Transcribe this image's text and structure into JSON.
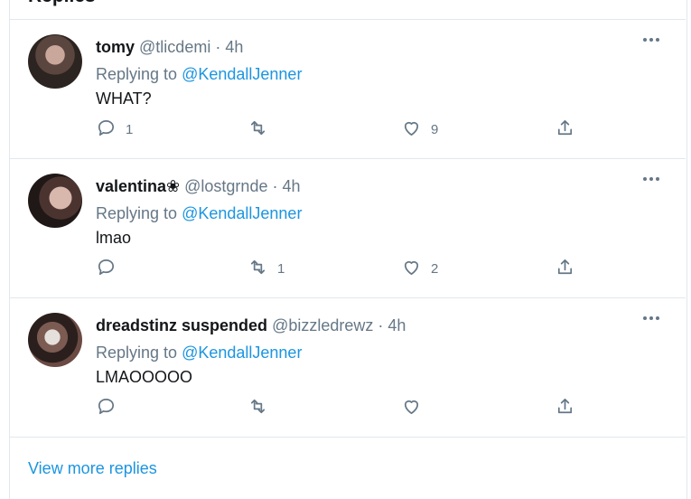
{
  "header": {
    "title": "Replies"
  },
  "tweets": [
    {
      "name": "tomy",
      "handle": "@tlicdemi",
      "time": "· 4h",
      "replying_prefix": "Replying to",
      "mention": "@KendallJenner",
      "text": "WHAT?",
      "reply_count": "1",
      "retweet_count": "",
      "like_count": "9"
    },
    {
      "name": "valentina❀",
      "handle": "@lostgrnde",
      "time": "· 4h",
      "replying_prefix": "Replying to",
      "mention": "@KendallJenner",
      "text": "lmao",
      "reply_count": "",
      "retweet_count": "1",
      "like_count": "2"
    },
    {
      "name": "dreadstinz suspended",
      "handle": "@bizzledrewz",
      "time": "· 4h",
      "replying_prefix": "Replying to",
      "mention": "@KendallJenner",
      "text": "LMAOOOOO",
      "reply_count": "",
      "retweet_count": "",
      "like_count": ""
    }
  ],
  "footer": {
    "view_more": "View more replies"
  },
  "colors": {
    "accent": "#1b95e0",
    "muted": "#657786",
    "border": "#e1e8ed",
    "text": "#14171a"
  },
  "icons": [
    "more-icon",
    "reply-icon",
    "retweet-icon",
    "like-icon",
    "share-icon"
  ]
}
